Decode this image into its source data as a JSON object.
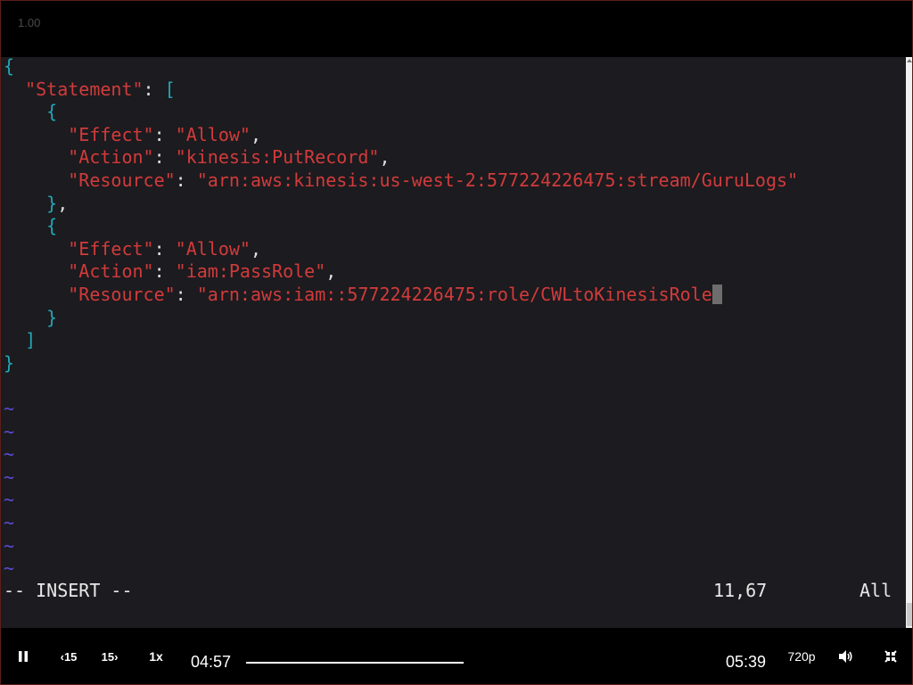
{
  "player": {
    "version_label": "1.00",
    "current_time": "04:57",
    "duration": "05:39",
    "speed_label": "1x",
    "rewind_label": "15",
    "forward_label": "15",
    "quality_label": "720p",
    "progress_fraction": 0.9
  },
  "editor": {
    "lines": [
      {
        "segs": [
          {
            "c": "brace",
            "t": "{"
          }
        ]
      },
      {
        "segs": [
          {
            "c": "punct",
            "t": "  "
          },
          {
            "c": "key",
            "t": "\"Statement\""
          },
          {
            "c": "punct",
            "t": ": "
          },
          {
            "c": "brace",
            "t": "["
          }
        ]
      },
      {
        "segs": [
          {
            "c": "punct",
            "t": "    "
          },
          {
            "c": "brace",
            "t": "{"
          }
        ]
      },
      {
        "segs": [
          {
            "c": "punct",
            "t": "      "
          },
          {
            "c": "key",
            "t": "\"Effect\""
          },
          {
            "c": "punct",
            "t": ": "
          },
          {
            "c": "val",
            "t": "\"Allow\""
          },
          {
            "c": "punct",
            "t": ","
          }
        ]
      },
      {
        "segs": [
          {
            "c": "punct",
            "t": "      "
          },
          {
            "c": "key",
            "t": "\"Action\""
          },
          {
            "c": "punct",
            "t": ": "
          },
          {
            "c": "val",
            "t": "\"kinesis:PutRecord\""
          },
          {
            "c": "punct",
            "t": ","
          }
        ]
      },
      {
        "segs": [
          {
            "c": "punct",
            "t": "      "
          },
          {
            "c": "key",
            "t": "\"Resource\""
          },
          {
            "c": "punct",
            "t": ": "
          },
          {
            "c": "val",
            "t": "\"arn:aws:kinesis:us-west-2:577224226475:stream/GuruLogs\""
          }
        ]
      },
      {
        "segs": [
          {
            "c": "punct",
            "t": "    "
          },
          {
            "c": "brace",
            "t": "}"
          },
          {
            "c": "punct",
            "t": ","
          }
        ]
      },
      {
        "segs": [
          {
            "c": "punct",
            "t": "    "
          },
          {
            "c": "brace",
            "t": "{"
          }
        ]
      },
      {
        "segs": [
          {
            "c": "punct",
            "t": "      "
          },
          {
            "c": "key",
            "t": "\"Effect\""
          },
          {
            "c": "punct",
            "t": ": "
          },
          {
            "c": "val",
            "t": "\"Allow\""
          },
          {
            "c": "punct",
            "t": ","
          }
        ]
      },
      {
        "segs": [
          {
            "c": "punct",
            "t": "      "
          },
          {
            "c": "key",
            "t": "\"Action\""
          },
          {
            "c": "punct",
            "t": ": "
          },
          {
            "c": "val",
            "t": "\"iam:PassRole\""
          },
          {
            "c": "punct",
            "t": ","
          }
        ]
      },
      {
        "segs": [
          {
            "c": "punct",
            "t": "      "
          },
          {
            "c": "key",
            "t": "\"Resource\""
          },
          {
            "c": "punct",
            "t": ": "
          },
          {
            "c": "val",
            "t": "\"arn:aws:iam::577224226475:role/CWLtoKinesisRole"
          },
          {
            "c": "cursor",
            "t": "\""
          }
        ]
      },
      {
        "segs": [
          {
            "c": "punct",
            "t": "    "
          },
          {
            "c": "brace",
            "t": "}"
          }
        ]
      },
      {
        "segs": [
          {
            "c": "punct",
            "t": "  "
          },
          {
            "c": "brace",
            "t": "]"
          }
        ]
      },
      {
        "segs": [
          {
            "c": "brace",
            "t": "}"
          }
        ]
      },
      {
        "segs": []
      },
      {
        "segs": [
          {
            "c": "tilde",
            "t": "~"
          }
        ]
      },
      {
        "segs": [
          {
            "c": "tilde",
            "t": "~"
          }
        ]
      },
      {
        "segs": [
          {
            "c": "tilde",
            "t": "~"
          }
        ]
      },
      {
        "segs": [
          {
            "c": "tilde",
            "t": "~"
          }
        ]
      },
      {
        "segs": [
          {
            "c": "tilde",
            "t": "~"
          }
        ]
      },
      {
        "segs": [
          {
            "c": "tilde",
            "t": "~"
          }
        ]
      },
      {
        "segs": [
          {
            "c": "tilde",
            "t": "~"
          }
        ]
      },
      {
        "segs": [
          {
            "c": "tilde",
            "t": "~"
          }
        ]
      }
    ],
    "status_mode": "-- INSERT --",
    "status_position": "11,67",
    "status_percent": "All"
  },
  "colors": {
    "brace": "#22a7b7",
    "string": "#d13b3b",
    "tilde": "#5b4bd4",
    "background": "#1c1b1f"
  },
  "icons": {
    "pause": "pause-icon",
    "rewind": "rewind-15-icon",
    "forward": "forward-15-icon",
    "volume": "volume-icon",
    "fullscreen": "exit-fullscreen-icon"
  }
}
